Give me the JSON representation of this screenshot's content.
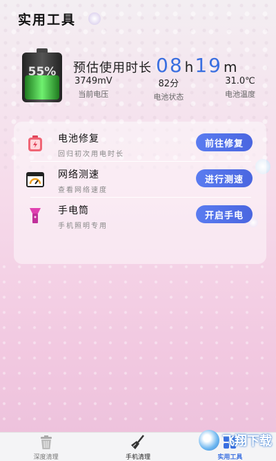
{
  "header": {
    "title": "实用工具"
  },
  "battery": {
    "level_percent": 55,
    "level_label": "55%",
    "estimate_label": "预估使用时长",
    "hours": "08",
    "hours_unit": "h",
    "minutes": "19",
    "minutes_unit": "m",
    "stats": [
      {
        "value": "3749mV",
        "label": "当前电压"
      },
      {
        "value": "82分",
        "label": "电池状态"
      },
      {
        "value": "31.0℃",
        "label": "电池温度"
      }
    ]
  },
  "tools": [
    {
      "title": "电池修复",
      "subtitle": "回归初次用电时长",
      "button": "前往修复",
      "icon": "battery-repair-icon"
    },
    {
      "title": "网络测速",
      "subtitle": "查看网络速度",
      "button": "进行测速",
      "icon": "speed-gauge-icon"
    },
    {
      "title": "手电筒",
      "subtitle": "手机照明专用",
      "button": "开启手电",
      "icon": "flashlight-icon"
    }
  ],
  "nav": {
    "items": [
      {
        "label": "深度清理",
        "icon": "trash-icon"
      },
      {
        "label": "手机清理",
        "icon": "broom-icon"
      },
      {
        "label": "实用工具",
        "icon": "tools-icon"
      }
    ]
  },
  "watermark": {
    "text": "飞翔下载"
  },
  "colors": {
    "accent": "#3a6fe0",
    "button": "#4a66e0"
  }
}
